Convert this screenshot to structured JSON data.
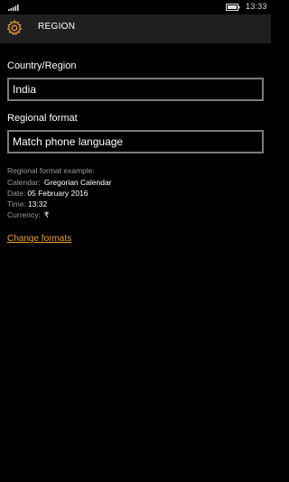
{
  "status_bar": {
    "time": "13:33",
    "icons": [
      "signal-icon",
      "battery-icon"
    ]
  },
  "header": {
    "icon": "gear-icon",
    "title": "REGION",
    "accent": "#f0a030"
  },
  "country": {
    "label": "Country/Region",
    "value": "India"
  },
  "regional_format": {
    "label": "Regional format",
    "value": "Match phone language"
  },
  "example": {
    "heading": "Regional format example:",
    "rows": [
      {
        "label": "Calendar:",
        "value": "Gregorian Calendar"
      },
      {
        "label": "Date:",
        "value": "05  February 2016"
      },
      {
        "label": "Time:",
        "value": "13:32"
      },
      {
        "label": "Currency:",
        "value": "₹"
      }
    ]
  },
  "change_formats_link": "Change formats"
}
